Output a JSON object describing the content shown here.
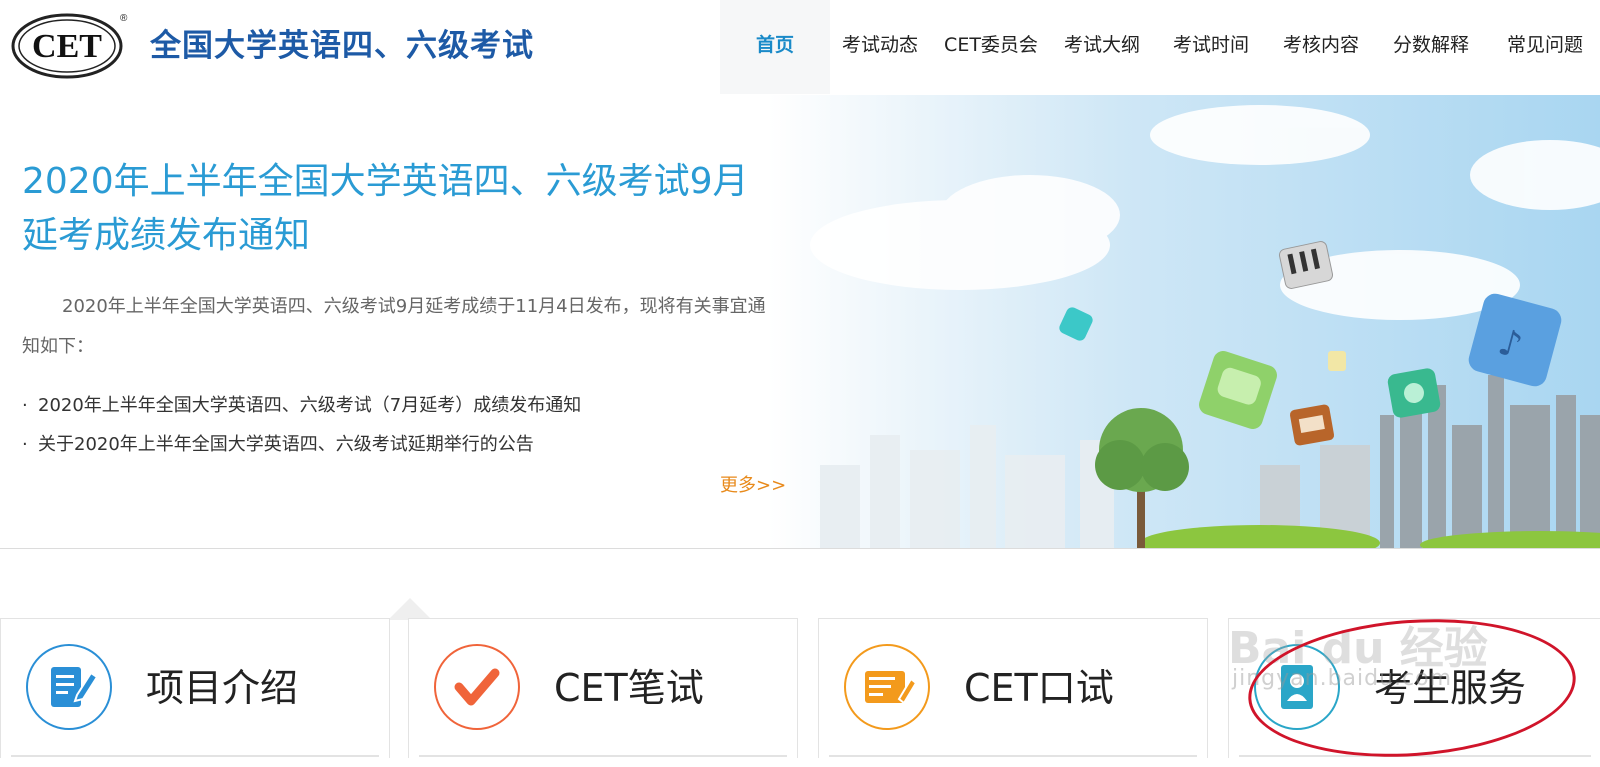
{
  "header": {
    "logo_text": "CET",
    "site_title": "全国大学英语四、六级考试",
    "nav": [
      {
        "label": "首页",
        "active": true
      },
      {
        "label": "考试动态",
        "active": false
      },
      {
        "label": "CET委员会",
        "active": false
      },
      {
        "label": "考试大纲",
        "active": false
      },
      {
        "label": "考试时间",
        "active": false
      },
      {
        "label": "考核内容",
        "active": false
      },
      {
        "label": "分数解释",
        "active": false
      },
      {
        "label": "常见问题",
        "active": false
      }
    ]
  },
  "banner": {
    "title": "2020年上半年全国大学英语四、六级考试9月延考成绩发布通知",
    "lead": "2020年上半年全国大学英语四、六级考试9月延考成绩于11月4日发布，现将有关事宜通知如下：",
    "bullet": "·",
    "links": [
      "2020年上半年全国大学英语四、六级考试（7月延考）成绩发布通知",
      "关于2020年上半年全国大学英语四、六级考试延期举行的公告"
    ],
    "more": "更多>>"
  },
  "cards": [
    {
      "label": "项目介绍",
      "icon": "document-edit-icon",
      "color": "#2a8fd6"
    },
    {
      "label": "CET笔试",
      "icon": "checkmark-icon",
      "color": "#f0643a"
    },
    {
      "label": "CET口试",
      "icon": "speaking-board-icon",
      "color": "#f39a1c"
    },
    {
      "label": "考生服务",
      "icon": "candidate-service-icon",
      "color": "#2aa6c8"
    }
  ],
  "watermark": {
    "brand": "Bai du 经验",
    "url": "jingyan.baidu.com"
  },
  "colors": {
    "accent": "#1a8ac8",
    "title_blue": "#2a9bd4",
    "more_orange": "#e88a1b",
    "annotation_red": "#d0142a"
  }
}
